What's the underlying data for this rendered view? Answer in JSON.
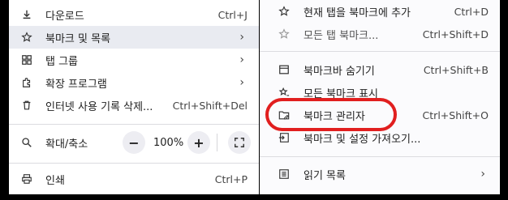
{
  "left_menu": {
    "items": [
      {
        "label": "다운로드",
        "shortcut": "Ctrl+J",
        "icon": "download-icon"
      },
      {
        "label": "북마크 및 목록",
        "chevron": "›",
        "icon": "star-icon"
      },
      {
        "label": "탭 그룹",
        "chevron": "›",
        "icon": "grid-icon"
      },
      {
        "label": "확장 프로그램",
        "chevron": "›",
        "icon": "puzzle-icon"
      },
      {
        "label": "인터넷 사용 기록 삭제...",
        "shortcut": "Ctrl+Shift+Del",
        "icon": "trash-icon"
      }
    ],
    "zoom": {
      "label": "확대/축소",
      "minus": "−",
      "value": "100%",
      "plus": "+",
      "icon": "zoom-icon"
    },
    "print": {
      "label": "인쇄",
      "shortcut": "Ctrl+P",
      "icon": "printer-icon"
    }
  },
  "right_menu": {
    "items": [
      {
        "label": "현재 탭을 북마크에 추가",
        "shortcut": "Ctrl+D",
        "icon": "star-icon"
      },
      {
        "label": "모든 탭 북마크...",
        "shortcut": "Ctrl+Shift+D",
        "icon": "star-icon"
      },
      {
        "label": "북마크바 숨기기",
        "shortcut": "Ctrl+Shift+B",
        "icon": "bookmark-bar-icon"
      },
      {
        "label": "모든 북마크 표시",
        "shortcut": "",
        "icon": "stars-icon"
      },
      {
        "label": "북마크 관리자",
        "shortcut": "Ctrl+Shift+O",
        "icon": "folder-edit-icon"
      },
      {
        "label": "북마크 및 설정 가져오기...",
        "shortcut": "",
        "icon": "import-icon"
      },
      {
        "label": "읽기 목록",
        "chevron": "›",
        "icon": "reading-list-icon"
      }
    ]
  },
  "annotation_color": "#e11f1f"
}
